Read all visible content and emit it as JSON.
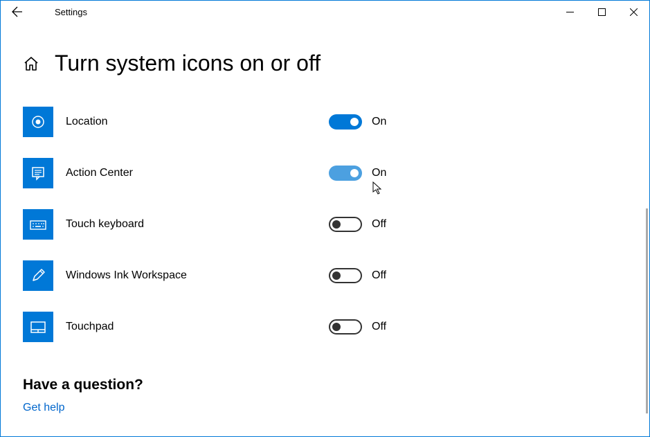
{
  "titlebar": {
    "app_title": "Settings"
  },
  "page": {
    "title": "Turn system icons on or off"
  },
  "items": [
    {
      "icon": "location-icon",
      "label": "Location",
      "on": true,
      "state": "On",
      "hover": false
    },
    {
      "icon": "action-center-icon",
      "label": "Action Center",
      "on": true,
      "state": "On",
      "hover": true
    },
    {
      "icon": "touch-keyboard-icon",
      "label": "Touch keyboard",
      "on": false,
      "state": "Off",
      "hover": false
    },
    {
      "icon": "ink-workspace-icon",
      "label": "Windows Ink Workspace",
      "on": false,
      "state": "Off",
      "hover": false
    },
    {
      "icon": "touchpad-icon",
      "label": "Touchpad",
      "on": false,
      "state": "Off",
      "hover": false
    }
  ],
  "question": {
    "title": "Have a question?",
    "link": "Get help"
  }
}
